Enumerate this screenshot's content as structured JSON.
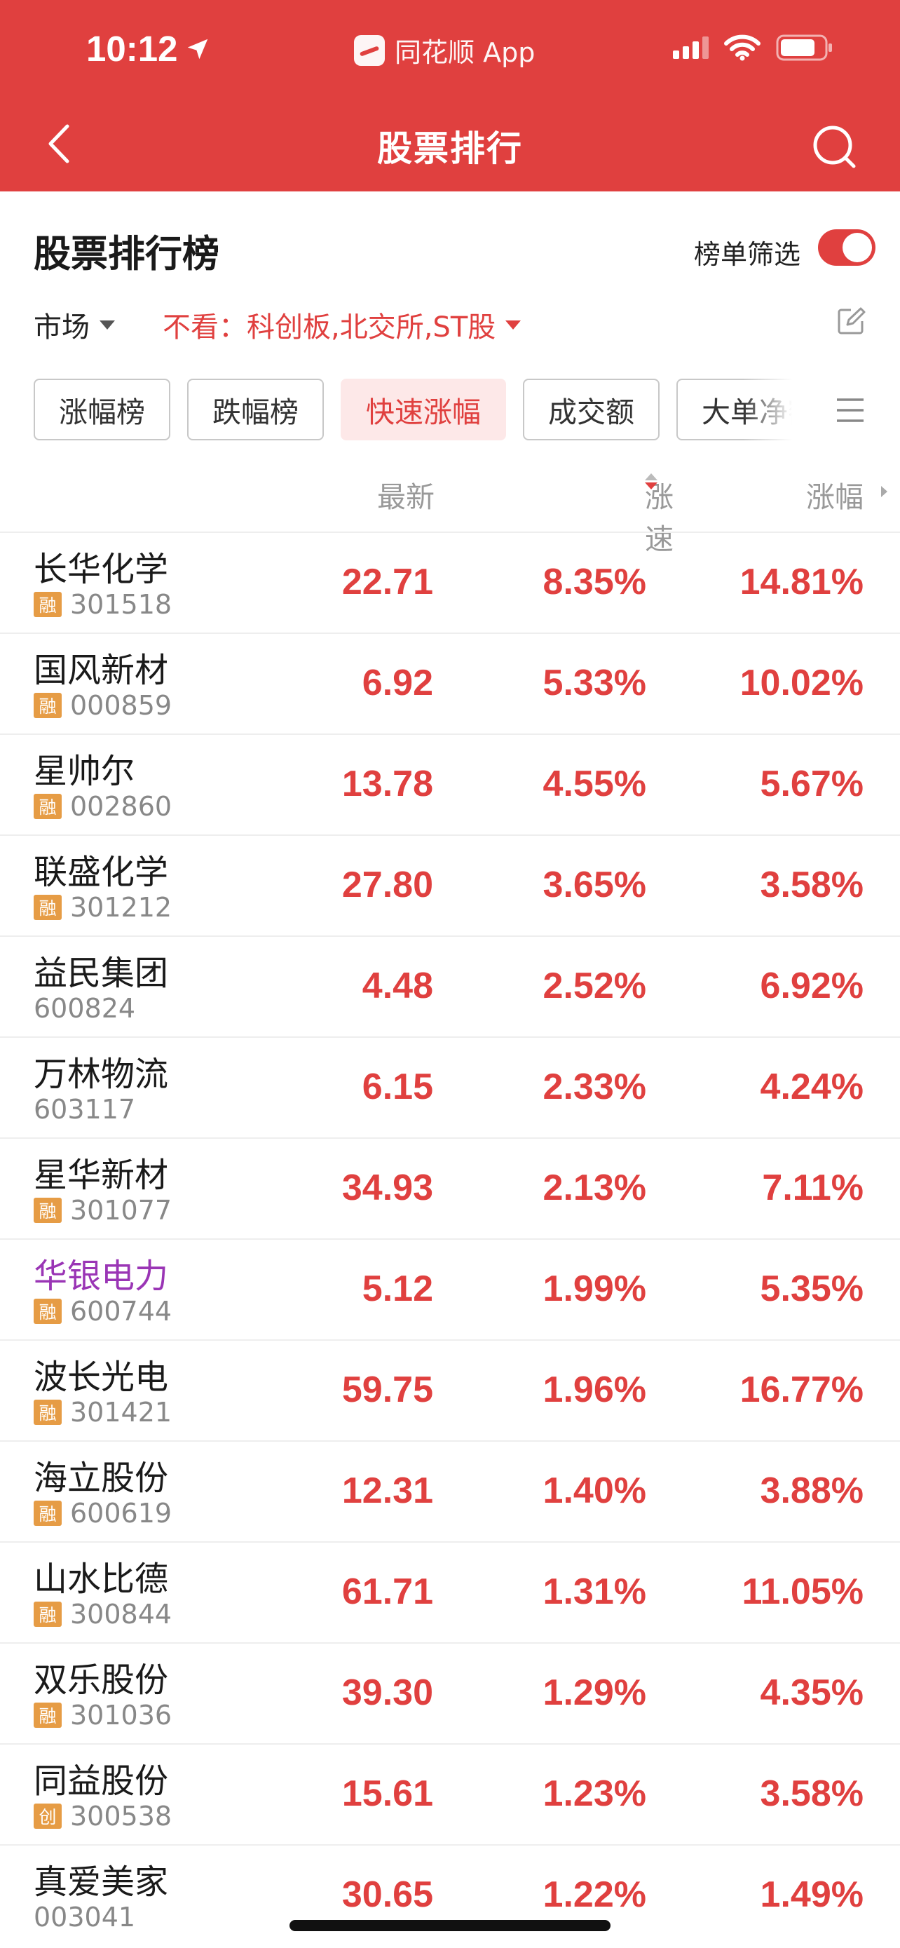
{
  "status_bar": {
    "time": "10:12",
    "back_app": "同花顺 App"
  },
  "nav": {
    "title": "股票排行"
  },
  "section": {
    "title": "股票排行榜",
    "filter_label": "榜单筛选",
    "filter_on": true
  },
  "filters": {
    "market_label": "市场",
    "exclude_label": "不看：科创板,北交所,ST股"
  },
  "tabs": [
    {
      "label": "涨幅榜",
      "active": false
    },
    {
      "label": "跌幅榜",
      "active": false
    },
    {
      "label": "快速涨幅",
      "active": true
    },
    {
      "label": "成交额",
      "active": false
    },
    {
      "label": "大单净额",
      "active": false
    }
  ],
  "columns": {
    "latest": "最新",
    "speed": "涨速",
    "change": "涨幅"
  },
  "colors": {
    "brand": "#e0403f",
    "badge": "#e69c45",
    "highlight_name": "#9a35b5"
  },
  "rows": [
    {
      "name": "长华化学",
      "badge": "融",
      "code": "301518",
      "latest": "22.71",
      "speed": "8.35%",
      "change": "14.81%",
      "highlight": false
    },
    {
      "name": "国风新材",
      "badge": "融",
      "code": "000859",
      "latest": "6.92",
      "speed": "5.33%",
      "change": "10.02%",
      "highlight": false
    },
    {
      "name": "星帅尔",
      "badge": "融",
      "code": "002860",
      "latest": "13.78",
      "speed": "4.55%",
      "change": "5.67%",
      "highlight": false
    },
    {
      "name": "联盛化学",
      "badge": "融",
      "code": "301212",
      "latest": "27.80",
      "speed": "3.65%",
      "change": "3.58%",
      "highlight": false
    },
    {
      "name": "益民集团",
      "badge": "",
      "code": "600824",
      "latest": "4.48",
      "speed": "2.52%",
      "change": "6.92%",
      "highlight": false
    },
    {
      "name": "万林物流",
      "badge": "",
      "code": "603117",
      "latest": "6.15",
      "speed": "2.33%",
      "change": "4.24%",
      "highlight": false
    },
    {
      "name": "星华新材",
      "badge": "融",
      "code": "301077",
      "latest": "34.93",
      "speed": "2.13%",
      "change": "7.11%",
      "highlight": false
    },
    {
      "name": "华银电力",
      "badge": "融",
      "code": "600744",
      "latest": "5.12",
      "speed": "1.99%",
      "change": "5.35%",
      "highlight": true
    },
    {
      "name": "波长光电",
      "badge": "融",
      "code": "301421",
      "latest": "59.75",
      "speed": "1.96%",
      "change": "16.77%",
      "highlight": false
    },
    {
      "name": "海立股份",
      "badge": "融",
      "code": "600619",
      "latest": "12.31",
      "speed": "1.40%",
      "change": "3.88%",
      "highlight": false
    },
    {
      "name": "山水比德",
      "badge": "融",
      "code": "300844",
      "latest": "61.71",
      "speed": "1.31%",
      "change": "11.05%",
      "highlight": false
    },
    {
      "name": "双乐股份",
      "badge": "融",
      "code": "301036",
      "latest": "39.30",
      "speed": "1.29%",
      "change": "4.35%",
      "highlight": false
    },
    {
      "name": "同益股份",
      "badge": "创",
      "code": "300538",
      "latest": "15.61",
      "speed": "1.23%",
      "change": "3.58%",
      "highlight": false
    },
    {
      "name": "真爱美家",
      "badge": "",
      "code": "003041",
      "latest": "30.65",
      "speed": "1.22%",
      "change": "1.49%",
      "highlight": false
    }
  ]
}
